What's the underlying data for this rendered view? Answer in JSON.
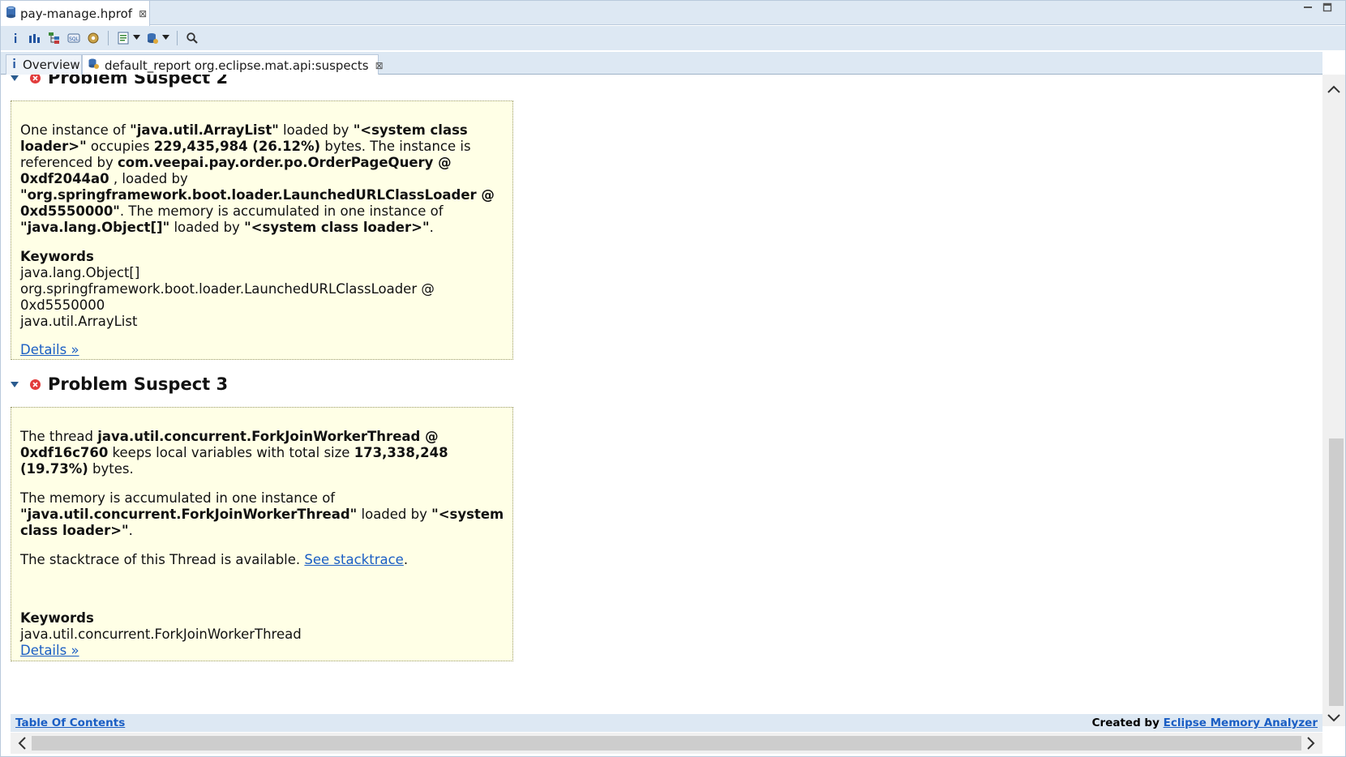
{
  "editor": {
    "file_tab": "pay-manage.hprof",
    "close_glyph": "⊠"
  },
  "toolbar": {
    "icons": [
      "info-icon",
      "histogram-icon",
      "dominator-tree-icon",
      "oql-icon",
      "thread-icon",
      "report-icon",
      "heap-dump-icon",
      "search-icon"
    ]
  },
  "tabs": {
    "overview": "Overview",
    "report": "default_report  org.eclipse.mat.api:suspects"
  },
  "suspect2": {
    "title": "Problem Suspect 2",
    "s1": "One instance of ",
    "b1": "\"java.util.ArrayList\"",
    "s2": " loaded by ",
    "b2": "\"<system class loader>\"",
    "s3": " occupies ",
    "b3": "229,435,984 (26.12%)",
    "s4": " bytes. The instance is referenced by ",
    "b4": "com.veepai.pay.order.po.OrderPageQuery @ 0xdf2044a0",
    "s5": " , loaded by ",
    "b5": "\"org.springframework.boot.loader.LaunchedURLClassLoader @ 0xd5550000\"",
    "s6": ". The memory is accumulated in one instance of ",
    "b6": "\"java.lang.Object[]\"",
    "s7": " loaded by ",
    "b7": "\"<system class loader>\"",
    "s8": ".",
    "keywords_title": "Keywords",
    "keywords": [
      "java.lang.Object[]",
      "org.springframework.boot.loader.LaunchedURLClassLoader @ 0xd5550000",
      "java.util.ArrayList"
    ],
    "details": "Details »"
  },
  "suspect3": {
    "title": "Problem Suspect 3",
    "s1": "The thread ",
    "b1": "java.util.concurrent.ForkJoinWorkerThread @ 0xdf16c760",
    "s2": " keeps local variables with total size ",
    "b2": "173,338,248 (19.73%)",
    "s3": " bytes.",
    "p2a": "The memory is accumulated in one instance of ",
    "p2b": "\"java.util.concurrent.ForkJoinWorkerThread\"",
    "p2c": " loaded by ",
    "p2d": "\"<system class loader>\"",
    "p2e": ".",
    "p3a": "The stacktrace of this Thread is available. ",
    "p3link": "See stacktrace",
    "p3b": ".",
    "keywords_title": "Keywords",
    "keywords": [
      "java.util.concurrent.ForkJoinWorkerThread"
    ],
    "details": "Details »"
  },
  "footer": {
    "toc": "Table Of Contents",
    "created_by": "Created by ",
    "analyzer": "Eclipse Memory Analyzer"
  }
}
